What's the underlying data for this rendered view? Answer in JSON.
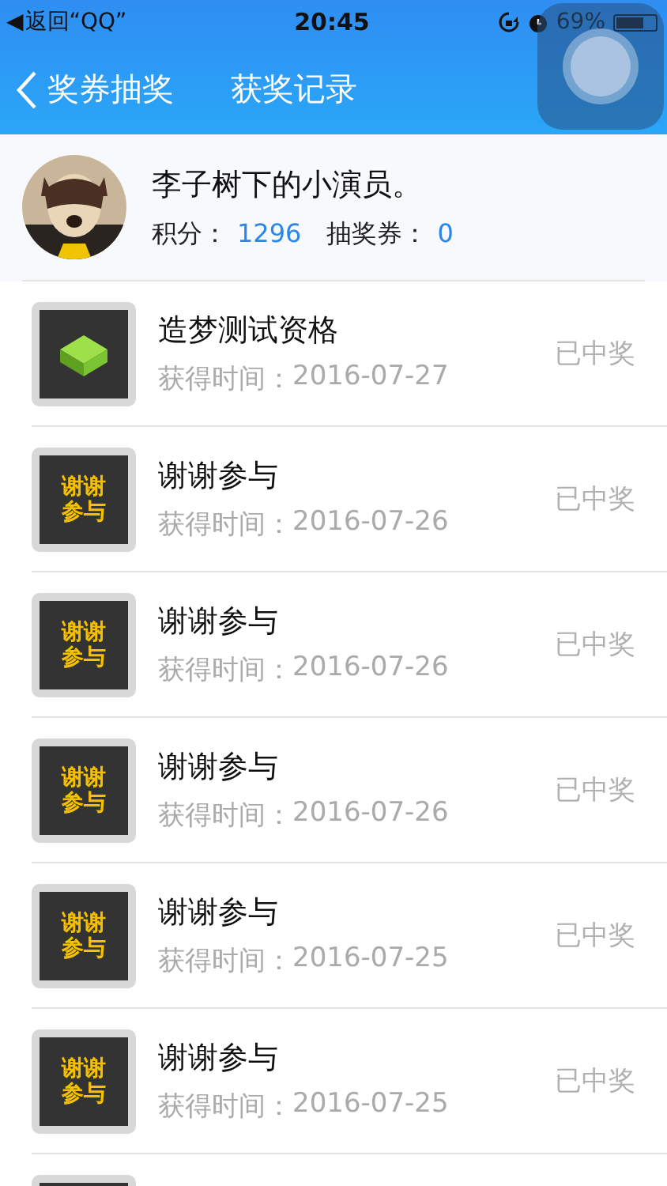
{
  "status_bar": {
    "back_arrow": "◀",
    "back_label": "返回“QQ”",
    "time": "20:45",
    "battery_text": "69%"
  },
  "nav": {
    "back_label": "奖券抽奖",
    "title": "获奖记录"
  },
  "profile": {
    "name": "李子树下的小演员。",
    "points_label": "积分：",
    "points": "1296",
    "tickets_label": "抽奖券：",
    "tickets": "0"
  },
  "records": [
    {
      "thumb": {
        "kind": "cube"
      },
      "title": "造梦测试资格",
      "time_label": "获得时间：",
      "date": "2016-07-27",
      "status": "已中奖"
    },
    {
      "thumb": {
        "kind": "label",
        "text": "谢谢参与"
      },
      "title": "谢谢参与",
      "time_label": "获得时间：",
      "date": "2016-07-26",
      "status": "已中奖"
    },
    {
      "thumb": {
        "kind": "label",
        "text": "谢谢参与"
      },
      "title": "谢谢参与",
      "time_label": "获得时间：",
      "date": "2016-07-26",
      "status": "已中奖"
    },
    {
      "thumb": {
        "kind": "label",
        "text": "谢谢参与"
      },
      "title": "谢谢参与",
      "time_label": "获得时间：",
      "date": "2016-07-26",
      "status": "已中奖"
    },
    {
      "thumb": {
        "kind": "label",
        "text": "谢谢参与"
      },
      "title": "谢谢参与",
      "time_label": "获得时间：",
      "date": "2016-07-25",
      "status": "已中奖"
    },
    {
      "thumb": {
        "kind": "label",
        "text": "谢谢参与"
      },
      "title": "谢谢参与",
      "time_label": "获得时间：",
      "date": "2016-07-25",
      "status": "已中奖"
    },
    {
      "thumb": {
        "kind": "cut"
      }
    }
  ]
}
